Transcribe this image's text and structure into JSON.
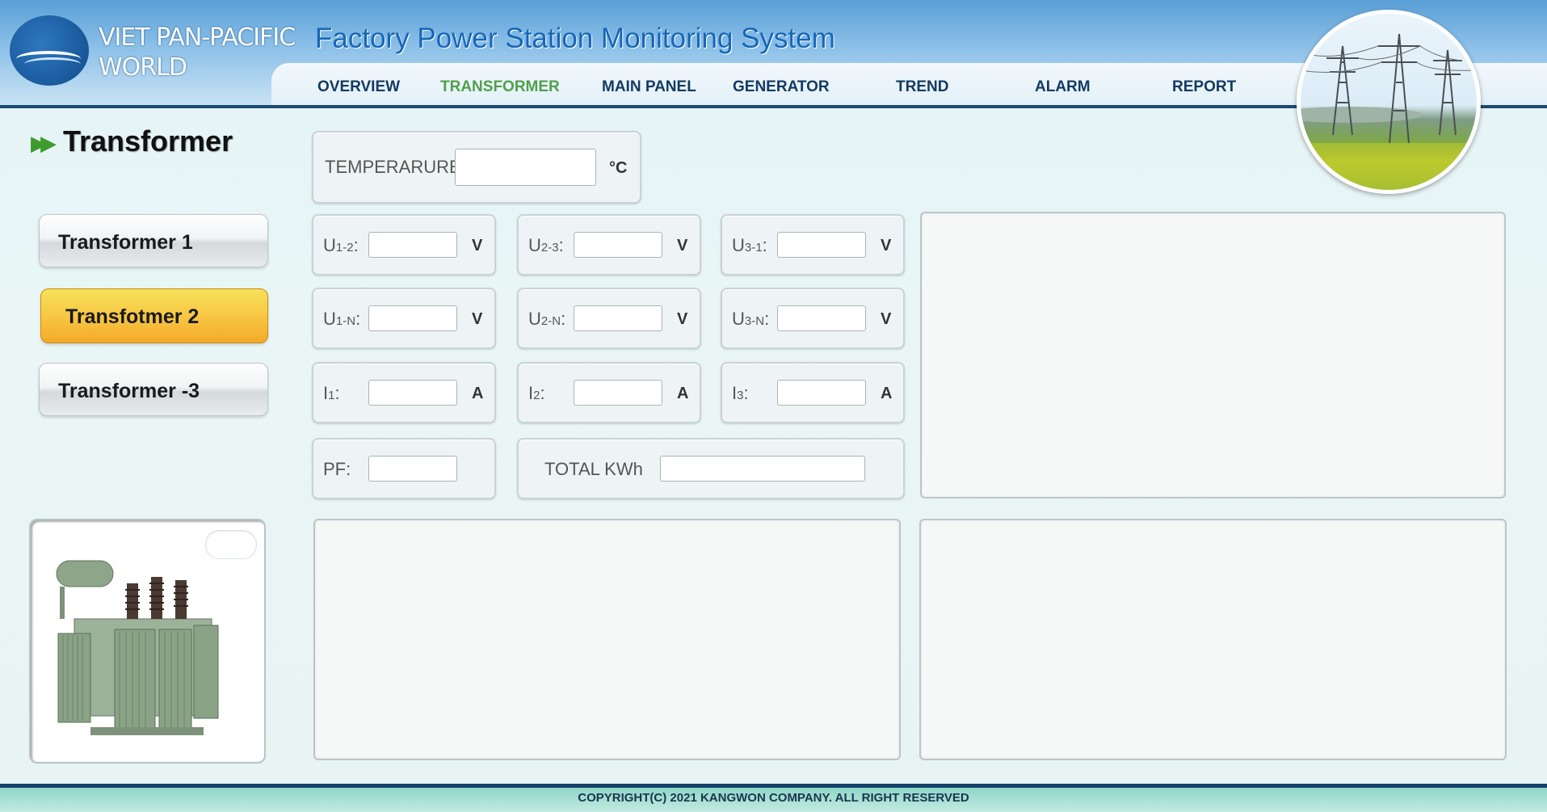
{
  "brand": {
    "line1": "VIET PAN-PACIFIC",
    "line2": "WORLD"
  },
  "app_title": "Factory Power Station Monitoring System",
  "nav": {
    "overview": "OVERVIEW",
    "transformer": "TRANSFORMER",
    "main_panel": "MAIN PANEL",
    "generator": "GENERATOR",
    "trend": "TREND",
    "alarm": "ALARM",
    "report": "REPORT",
    "active": "TRANSFORMER"
  },
  "page": {
    "title": "Transformer"
  },
  "sidebar": {
    "items": [
      {
        "label": "Transformer 1",
        "active": false
      },
      {
        "label": "Transfotmer 2",
        "active": true
      },
      {
        "label": "Transformer -3",
        "active": false
      }
    ]
  },
  "temperature": {
    "label": "TEMPERARURE:",
    "value": "",
    "unit": "°C"
  },
  "voltages_ll": [
    {
      "label": "U",
      "sub": "1-2",
      "colon": ":",
      "value": "",
      "unit": "V"
    },
    {
      "label": "U",
      "sub": "2-3",
      "colon": ":",
      "value": "",
      "unit": "V"
    },
    {
      "label": "U",
      "sub": "3-1",
      "colon": ":",
      "value": "",
      "unit": "V"
    }
  ],
  "voltages_ln": [
    {
      "label": "U",
      "sub": "1-N",
      "colon": ":",
      "value": "",
      "unit": "V"
    },
    {
      "label": "U",
      "sub": "2-N",
      "colon": ":",
      "value": "",
      "unit": "V"
    },
    {
      "label": "U",
      "sub": "3-N",
      "colon": ":",
      "value": "",
      "unit": "V"
    }
  ],
  "currents": [
    {
      "label": "I",
      "sub": "1",
      "colon": ":",
      "value": "",
      "unit": "A"
    },
    {
      "label": "I",
      "sub": "2",
      "colon": ":",
      "value": "",
      "unit": "A"
    },
    {
      "label": "I",
      "sub": "3",
      "colon": ":",
      "value": "",
      "unit": "A"
    }
  ],
  "pf": {
    "label": "PF:",
    "value": ""
  },
  "total_kwh": {
    "label": "TOTAL KWh",
    "value": ""
  },
  "footer": {
    "copyright": "COPYRIGHT(C) 2021 KANGWON COMPANY. ALL RIGHT RESERVED"
  },
  "colors": {
    "header_blue": "#5a9fd6",
    "nav_text": "#123b63",
    "nav_active": "#4ea14a",
    "active_button": "#f7c843",
    "footer_bar": "#14426a"
  }
}
